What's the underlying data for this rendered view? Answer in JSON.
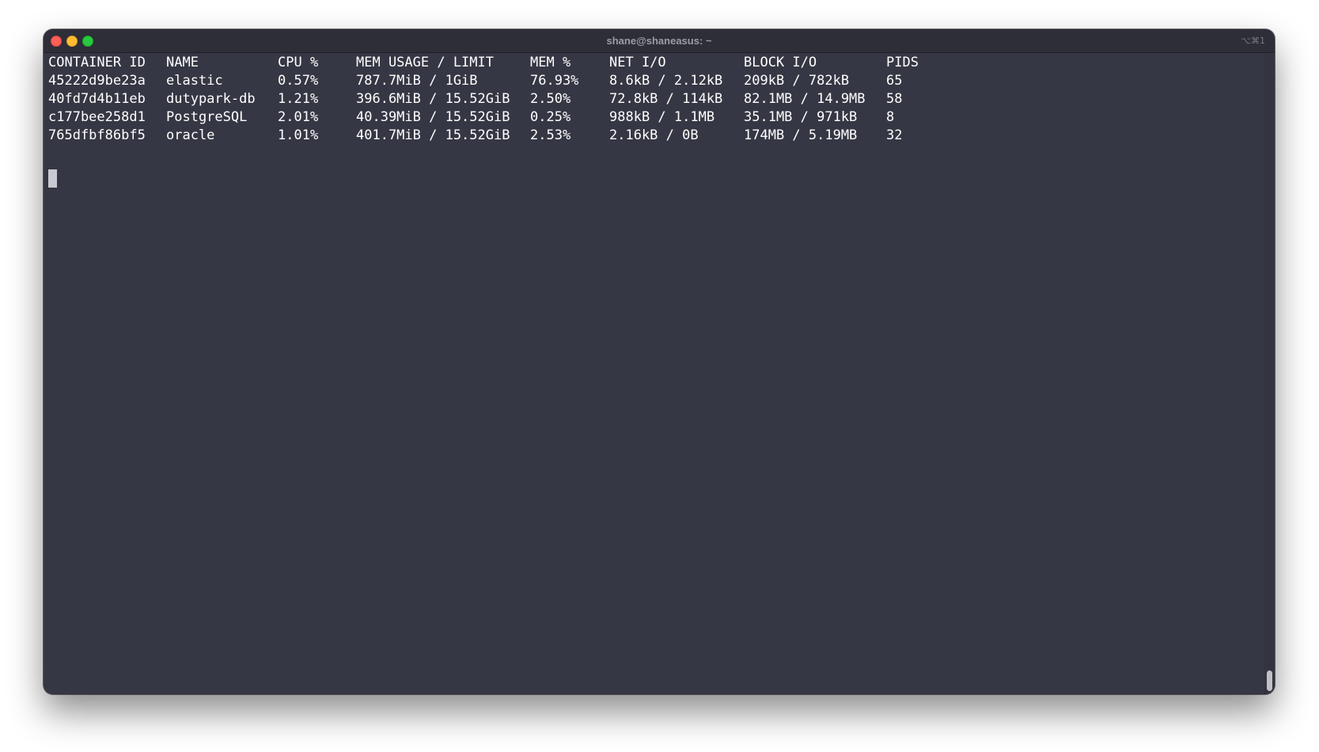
{
  "window": {
    "title": "shane@shaneasus: ~",
    "shortcut": "⌥⌘1"
  },
  "terminal": {
    "headers": [
      "CONTAINER ID",
      "NAME",
      "CPU %",
      "MEM USAGE / LIMIT",
      "MEM %",
      "NET I/O",
      "BLOCK I/O",
      "PIDS"
    ],
    "rows": [
      [
        "45222d9be23a",
        "elastic",
        "0.57%",
        "787.7MiB / 1GiB",
        "76.93%",
        "8.6kB / 2.12kB",
        "209kB / 782kB",
        "65"
      ],
      [
        "40fd7d4b11eb",
        "dutypark-db",
        "1.21%",
        "396.6MiB / 15.52GiB",
        "2.50%",
        "72.8kB / 114kB",
        "82.1MB / 14.9MB",
        "58"
      ],
      [
        "c177bee258d1",
        "PostgreSQL",
        "2.01%",
        "40.39MiB / 15.52GiB",
        "0.25%",
        "988kB / 1.1MB",
        "35.1MB / 971kB",
        "8"
      ],
      [
        "765dfbf86bf5",
        "oracle",
        "1.01%",
        "401.7MiB / 15.52GiB",
        "2.53%",
        "2.16kB / 0B",
        "174MB / 5.19MB",
        "32"
      ]
    ]
  },
  "colors": {
    "background": "#363744",
    "text": "#ffffff",
    "close": "#fe5f57",
    "minimize": "#febc2e",
    "maximize": "#28c840"
  }
}
